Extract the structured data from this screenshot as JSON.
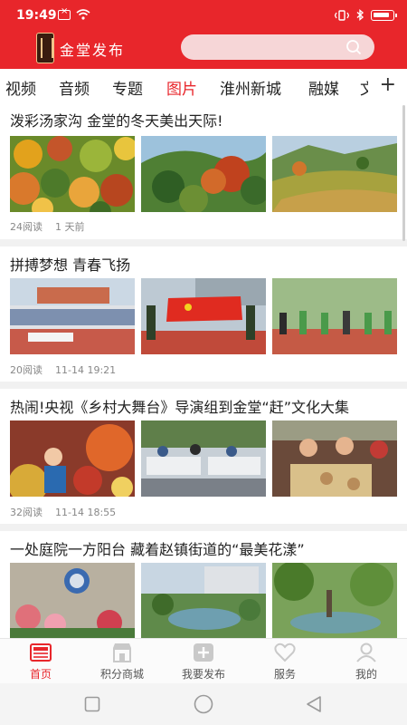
{
  "colors": {
    "brand_red": "#e8262b",
    "search_bg": "#f6d6d7",
    "text": "#222222",
    "meta": "#888888"
  },
  "status_bar": {
    "time": "19:49"
  },
  "header": {
    "brand": "金堂发布",
    "search_placeholder": ""
  },
  "tabs": [
    {
      "label": "视频",
      "active": false
    },
    {
      "label": "音频",
      "active": false
    },
    {
      "label": "专题",
      "active": false
    },
    {
      "label": "图片",
      "active": true
    },
    {
      "label": "淮州新城",
      "active": false
    },
    {
      "label": "融媒",
      "active": false
    },
    {
      "label": "文",
      "active": false
    }
  ],
  "feed": [
    {
      "title": "泼彩汤家沟 金堂的冬天美出天际!",
      "reads": "24阅读",
      "time": "1 天前"
    },
    {
      "title": "拼搏梦想  青春飞扬",
      "reads": "20阅读",
      "time": "11-14 19:21"
    },
    {
      "title": "热闹!央视《乡村大舞台》导演组到金堂“赶”文化大集",
      "reads": "32阅读",
      "time": "11-14 18:55"
    },
    {
      "title": "一处庭院一方阳台 藏着赵镇街道的“最美花漾”",
      "reads": "",
      "time": ""
    }
  ],
  "bottom_nav": [
    {
      "label": "首页",
      "icon": "newspaper-icon",
      "active": true
    },
    {
      "label": "积分商城",
      "icon": "shop-icon",
      "active": false
    },
    {
      "label": "我要发布",
      "icon": "add-post-icon",
      "active": false
    },
    {
      "label": "服务",
      "icon": "heart-icon",
      "active": false
    },
    {
      "label": "我的",
      "icon": "person-icon",
      "active": false
    }
  ]
}
